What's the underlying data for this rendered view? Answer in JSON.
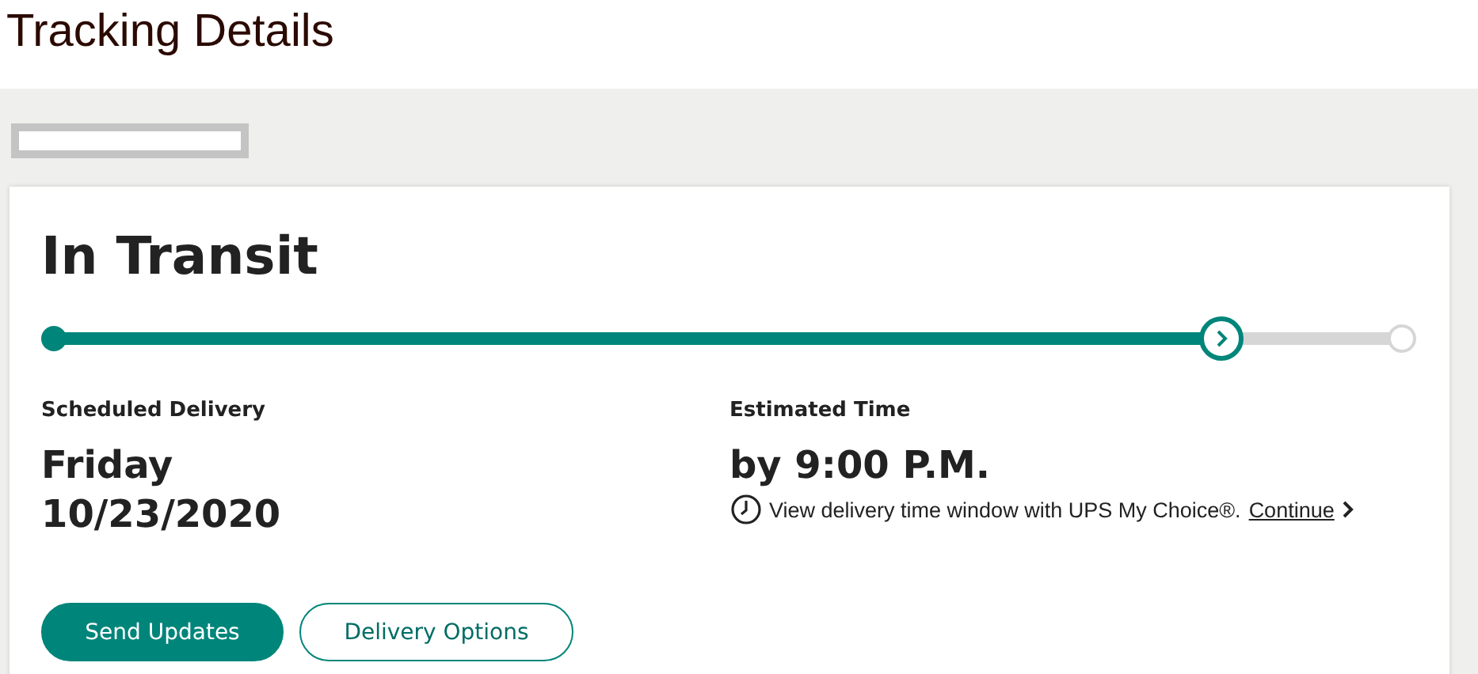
{
  "page_title": "Tracking Details",
  "status": "In Transit",
  "progress": {
    "level": 0.866
  },
  "scheduled": {
    "label": "Scheduled Delivery",
    "day": "Friday",
    "date": "10/23/2020"
  },
  "estimated": {
    "label": "Estimated Time",
    "time": "by 9:00 P.M.",
    "note": "View delivery time window with UPS My Choice®.",
    "link": "Continue"
  },
  "buttons": [
    {
      "label": "Send Updates",
      "kind": "primary"
    },
    {
      "label": "Delivery Options",
      "kind": "outline"
    }
  ]
}
